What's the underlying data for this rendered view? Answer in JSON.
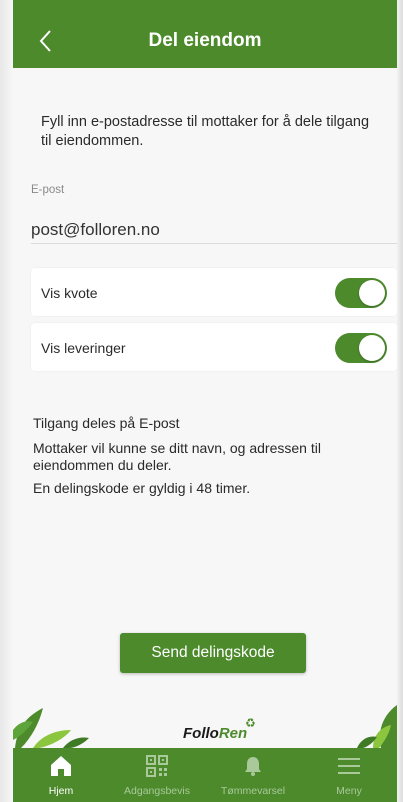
{
  "header": {
    "title": "Del eiendom"
  },
  "intro": "Fyll inn e-postadresse til mottaker for å dele tilgang til eiendommen.",
  "email": {
    "label": "E-post",
    "value": "post@folloren.no"
  },
  "toggles": [
    {
      "label": "Vis kvote",
      "on": true
    },
    {
      "label": "Vis leveringer",
      "on": true
    }
  ],
  "info": {
    "title": "Tilgang deles på E-post",
    "text": "Mottaker vil kunne se ditt navn, og adressen til eiendommen du deler.",
    "validity": "En delingskode er gyldig i 48 timer."
  },
  "send_button": "Send delingskode",
  "logo": {
    "part1": "Follo",
    "part2": "Ren"
  },
  "tabs": [
    {
      "label": "Hjem",
      "icon": "home-icon",
      "active": true
    },
    {
      "label": "Adgangsbevis",
      "icon": "qr-icon",
      "active": false
    },
    {
      "label": "Tømmevarsel",
      "icon": "bell-icon",
      "active": false
    },
    {
      "label": "Meny",
      "icon": "menu-icon",
      "active": false
    }
  ],
  "colors": {
    "accent": "#4c8a2c",
    "background": "#f7f7f7"
  }
}
